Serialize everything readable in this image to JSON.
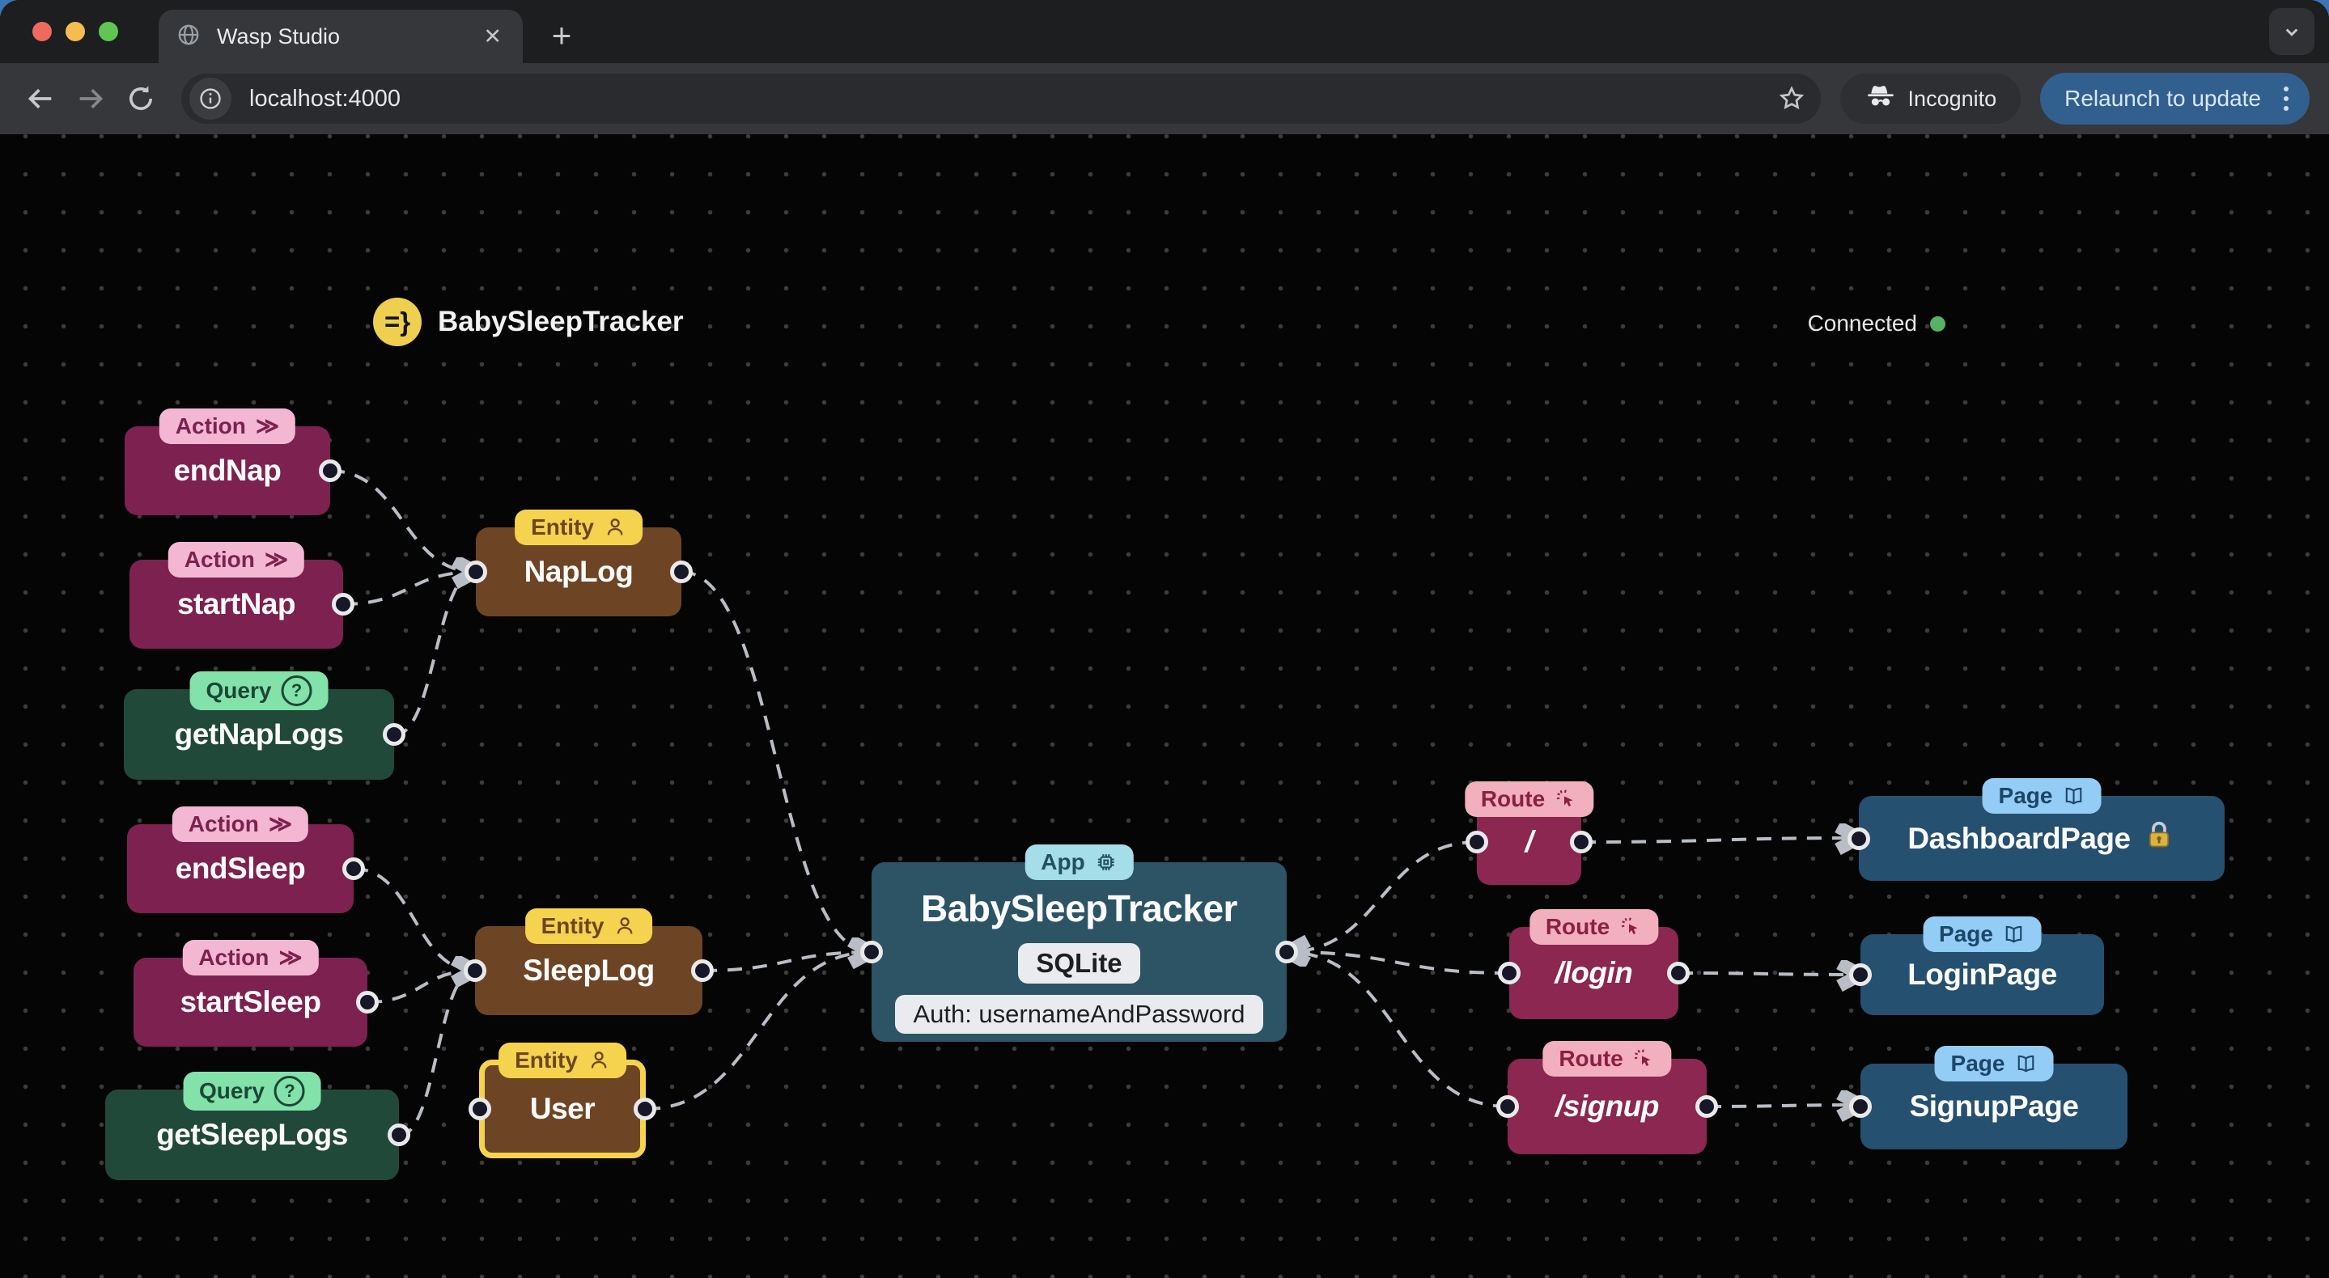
{
  "browser": {
    "tab_title": "Wasp Studio",
    "close_tab": "✕",
    "new_tab": "+",
    "url": "localhost:4000",
    "incognito_label": "Incognito",
    "relaunch_label": "Relaunch to update"
  },
  "header": {
    "logo_text": "=}",
    "app_title": "BabySleepTracker",
    "connection_status": "Connected"
  },
  "graph": {
    "nodes": [
      {
        "id": "endNap",
        "type": "action",
        "badge": "Action",
        "label": "endNap"
      },
      {
        "id": "startNap",
        "type": "action",
        "badge": "Action",
        "label": "startNap"
      },
      {
        "id": "getNapLogs",
        "type": "query",
        "badge": "Query",
        "label": "getNapLogs"
      },
      {
        "id": "NapLog",
        "type": "entity",
        "badge": "Entity",
        "label": "NapLog"
      },
      {
        "id": "endSleep",
        "type": "action",
        "badge": "Action",
        "label": "endSleep"
      },
      {
        "id": "startSleep",
        "type": "action",
        "badge": "Action",
        "label": "startSleep"
      },
      {
        "id": "getSleepLogs",
        "type": "query",
        "badge": "Query",
        "label": "getSleepLogs"
      },
      {
        "id": "SleepLog",
        "type": "entity",
        "badge": "Entity",
        "label": "SleepLog"
      },
      {
        "id": "User",
        "type": "entity",
        "badge": "Entity",
        "label": "User",
        "highlighted": true
      },
      {
        "id": "app",
        "type": "app",
        "badge": "App",
        "label": "BabySleepTracker",
        "db": "SQLite",
        "auth": "Auth: usernameAndPassword"
      },
      {
        "id": "route-root",
        "type": "route",
        "badge": "Route",
        "label": "/"
      },
      {
        "id": "page-dashboard",
        "type": "page",
        "badge": "Page",
        "label": "DashboardPage",
        "auth_required": true
      },
      {
        "id": "route-login",
        "type": "route",
        "badge": "Route",
        "label": "/login"
      },
      {
        "id": "page-login",
        "type": "page",
        "badge": "Page",
        "label": "LoginPage"
      },
      {
        "id": "route-signup",
        "type": "route",
        "badge": "Route",
        "label": "/signup"
      },
      {
        "id": "page-signup",
        "type": "page",
        "badge": "Page",
        "label": "SignupPage"
      }
    ],
    "edges": [
      {
        "source": "endNap",
        "target": "NapLog"
      },
      {
        "source": "startNap",
        "target": "NapLog"
      },
      {
        "source": "getNapLogs",
        "target": "NapLog"
      },
      {
        "source": "NapLog",
        "target": "app"
      },
      {
        "source": "endSleep",
        "target": "SleepLog"
      },
      {
        "source": "startSleep",
        "target": "SleepLog"
      },
      {
        "source": "getSleepLogs",
        "target": "SleepLog"
      },
      {
        "source": "SleepLog",
        "target": "app"
      },
      {
        "source": "User",
        "target": "app"
      },
      {
        "source": "route-root",
        "target": "app"
      },
      {
        "source": "route-login",
        "target": "app"
      },
      {
        "source": "route-signup",
        "target": "app"
      },
      {
        "source": "route-root",
        "target": "page-dashboard"
      },
      {
        "source": "route-login",
        "target": "page-login"
      },
      {
        "source": "route-signup",
        "target": "page-signup"
      }
    ]
  },
  "colors": {
    "action_bg": "#7c2150",
    "action_badge": "#f3b7d3",
    "query_bg": "#21493a",
    "query_badge": "#82e2aa",
    "entity_bg": "#6e4524",
    "entity_badge": "#f5d34f",
    "app_bg": "#2c5465",
    "app_badge": "#a5dde9",
    "page_bg": "#26506f",
    "page_badge": "#93ccf5",
    "route_bg": "#8b2750",
    "route_badge": "#f2afbd",
    "edge": "#b9bdc5",
    "status_green": "#56b365",
    "update_button": "#31608f"
  }
}
